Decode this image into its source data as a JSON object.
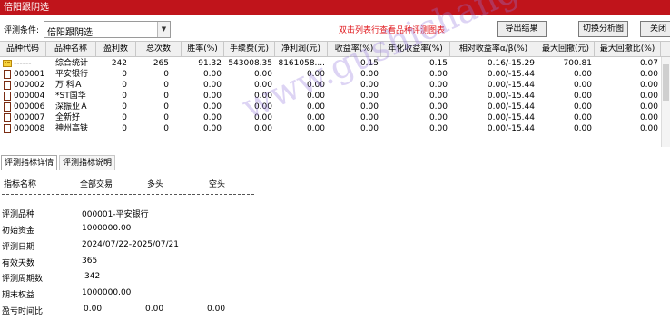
{
  "window": {
    "title": "倍阳跟阴选"
  },
  "toolbar": {
    "cond_label": "评测条件:",
    "condition_value": "倍阳跟阴选",
    "hint": "双击列表行查看品种评测图表",
    "export_label": "导出结果",
    "switch_label": "切换分析图",
    "close_label": "关闭"
  },
  "table": {
    "headers": [
      "品种代码",
      "品种名称",
      "盈利数",
      "总次数",
      "胜率(%)",
      "手续费(元)",
      "净利润(元)",
      "收益率(%)",
      "年化收益率(%)",
      "相对收益率α/β(%)",
      "最大回撤(元)",
      "最大回撤比(%)"
    ],
    "rows": [
      {
        "icon": "summary-icon",
        "code": "------",
        "name": "综合统计",
        "wins": "242",
        "total": "265",
        "winrate": "91.32",
        "fee": "543008.35",
        "profit": "8161058....",
        "ret": "0.15",
        "annual": "0.15",
        "rel": "0.16/-15.29",
        "dd": "700.81",
        "ddr": "0.07"
      },
      {
        "icon": "stock-icon",
        "code": "000001",
        "name": "平安银行",
        "wins": "0",
        "total": "0",
        "winrate": "0.00",
        "fee": "0.00",
        "profit": "0.00",
        "ret": "0.00",
        "annual": "0.00",
        "rel": "0.00/-15.44",
        "dd": "0.00",
        "ddr": "0.00"
      },
      {
        "icon": "stock-icon",
        "code": "000002",
        "name": "万 科Ａ",
        "wins": "0",
        "total": "0",
        "winrate": "0.00",
        "fee": "0.00",
        "profit": "0.00",
        "ret": "0.00",
        "annual": "0.00",
        "rel": "0.00/-15.44",
        "dd": "0.00",
        "ddr": "0.00"
      },
      {
        "icon": "stock-icon",
        "code": "000004",
        "name": "*ST国华",
        "wins": "0",
        "total": "0",
        "winrate": "0.00",
        "fee": "0.00",
        "profit": "0.00",
        "ret": "0.00",
        "annual": "0.00",
        "rel": "0.00/-15.44",
        "dd": "0.00",
        "ddr": "0.00"
      },
      {
        "icon": "stock-icon",
        "code": "000006",
        "name": "深振业Ａ",
        "wins": "0",
        "total": "0",
        "winrate": "0.00",
        "fee": "0.00",
        "profit": "0.00",
        "ret": "0.00",
        "annual": "0.00",
        "rel": "0.00/-15.44",
        "dd": "0.00",
        "ddr": "0.00"
      },
      {
        "icon": "stock-icon",
        "code": "000007",
        "name": "全新好",
        "wins": "0",
        "total": "0",
        "winrate": "0.00",
        "fee": "0.00",
        "profit": "0.00",
        "ret": "0.00",
        "annual": "0.00",
        "rel": "0.00/-15.44",
        "dd": "0.00",
        "ddr": "0.00"
      },
      {
        "icon": "stock-icon",
        "code": "000008",
        "name": "神州高铁",
        "wins": "0",
        "total": "0",
        "winrate": "0.00",
        "fee": "0.00",
        "profit": "0.00",
        "ret": "0.00",
        "annual": "0.00",
        "rel": "0.00/-15.44",
        "dd": "0.00",
        "ddr": "0.00"
      }
    ]
  },
  "tabs": [
    "评测指标详情",
    "评测指标说明"
  ],
  "detail": {
    "col_headers": [
      "指标名称",
      "全部交易",
      "多头",
      "空头"
    ],
    "rows": [
      {
        "label": "评测品种",
        "value": "000001-平安银行"
      },
      {
        "label": "初始资金",
        "value": "1000000.00"
      },
      {
        "label": "评测日期",
        "value": "2024/07/22-2025/07/21"
      },
      {
        "label": "有效天数",
        "value": "365"
      },
      {
        "label": "评测周期数",
        "value": "342"
      },
      {
        "label": "期末权益",
        "value": "1000000.00"
      }
    ],
    "last_row": {
      "label": "盈亏时间比",
      "all": "0.00",
      "long": "0.00",
      "short": "0.00"
    }
  },
  "watermark": "www.gushichanghong.com",
  "colors": {
    "titlebar": "#c0141b",
    "hint": "#e0161b",
    "header_bg": "#f0f0f0"
  }
}
